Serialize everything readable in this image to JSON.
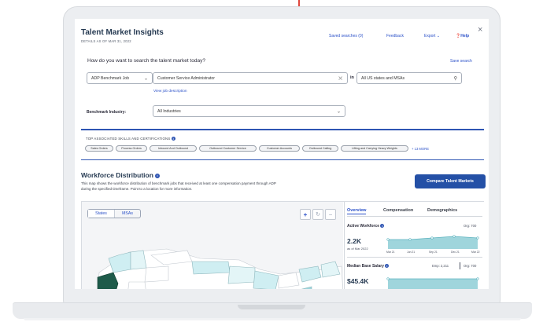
{
  "header": {
    "title": "Talent Market Insights",
    "subtitle": "DETAILS AS OF MAR 31, 2022",
    "links": [
      "Saved searches (0)",
      "Feedback",
      "Export",
      "Help"
    ],
    "close": "×"
  },
  "search": {
    "question": "How do you want to search the talent market today?",
    "save": "Save search",
    "type_value": "ADP Benchmark Job",
    "job_value": "Customer Service Administrator",
    "in_label": "in",
    "location_value": "All US states and MSAs",
    "view_job_link": "View job description",
    "industry_label": "Benchmark Industry:",
    "industry_value": "All Industries"
  },
  "skills": {
    "heading": "TOP ASSOCIATED SKILLS AND CERTIFICATIONS",
    "chips": [
      "Sales Orders",
      "Process Orders",
      "Inbound And Outbound",
      "Outbound Customer Service",
      "Customer Accounts",
      "Outbound Calling",
      "Lifting and Carrying Heavy Weights"
    ],
    "more": "+ 13 MORE"
  },
  "workforce": {
    "title": "Workforce Distribution",
    "desc1": "This map shows the workforce distribution of benchmark jobs that received at least one compensation payment through ADP",
    "desc2": "during the specified timeframe. Point to a location for more information.",
    "compare_button": "Compare Talent Markets",
    "toggle_states": "States",
    "toggle_msas": "MSAs",
    "zoom_in": "+",
    "reset": "↻",
    "zoom_out": "−"
  },
  "overview": {
    "tabs": [
      "Overview",
      "Compensation",
      "Demographics"
    ],
    "active": {
      "label": "Active Workforce",
      "org": "Org: 700",
      "value": "2.2K",
      "asof": "as of Mar 2022",
      "xlabels": [
        "Mar 21",
        "Jun 21",
        "Sep 21",
        "Dec 21",
        "Mar 22"
      ]
    },
    "salary": {
      "label": "Median Base Salary",
      "emp": "Emp: 2,211",
      "org": "Org: 700",
      "value": "$45.4K"
    }
  },
  "colors": {
    "accent": "#2450a6",
    "map_light": "#cfeef2",
    "map_dark": "#1e5b4a",
    "chart_fill": "#9fd5dc"
  }
}
